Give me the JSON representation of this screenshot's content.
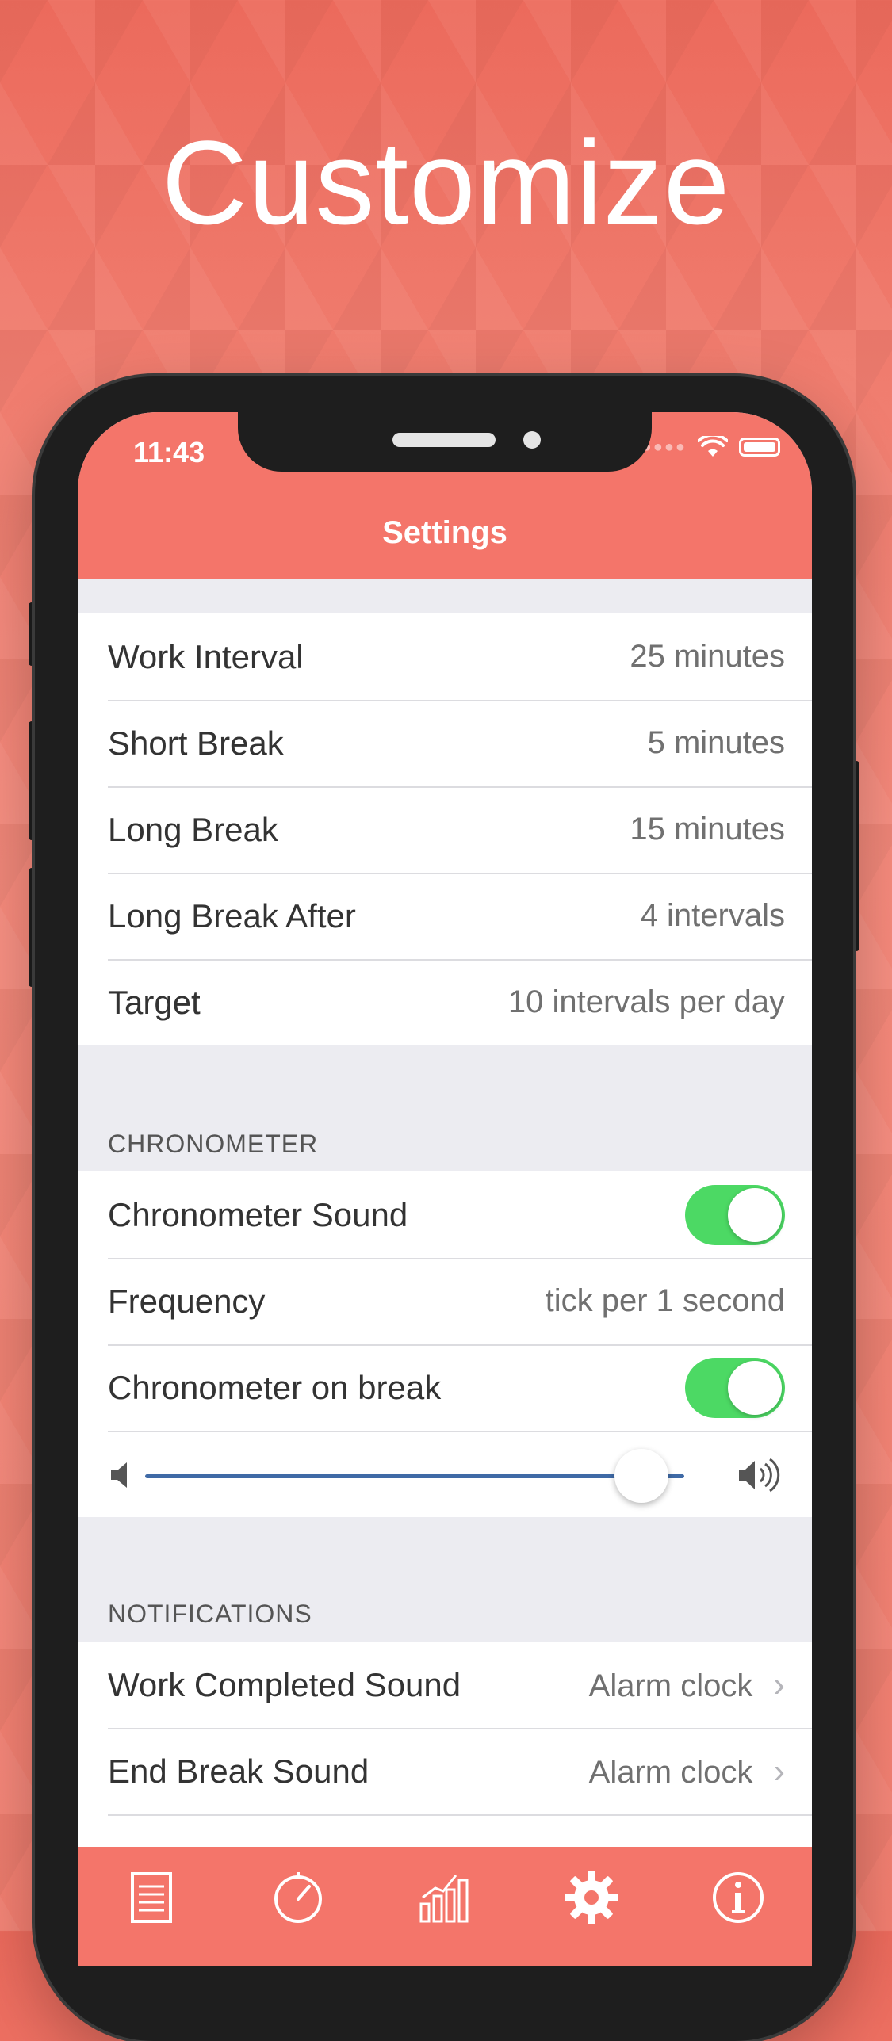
{
  "headline": "Customize",
  "status_bar": {
    "time": "11:43"
  },
  "nav": {
    "title": "Settings"
  },
  "timer_settings": [
    {
      "label": "Work Interval",
      "value": "25 minutes"
    },
    {
      "label": "Short Break",
      "value": "5 minutes"
    },
    {
      "label": "Long Break",
      "value": "15 minutes"
    },
    {
      "label": "Long Break After",
      "value": "4 intervals"
    },
    {
      "label": "Target",
      "value": "10 intervals per day"
    }
  ],
  "chronometer": {
    "header": "CHRONOMETER",
    "sound_label": "Chronometer Sound",
    "sound_on": true,
    "frequency_label": "Frequency",
    "frequency_value": "tick per 1 second",
    "on_break_label": "Chronometer on break",
    "on_break_on": true,
    "volume_fraction": 0.92
  },
  "notifications": {
    "header": "NOTIFICATIONS",
    "items": [
      {
        "label": "Work Completed Sound",
        "value": "Alarm clock"
      },
      {
        "label": "End Break Sound",
        "value": "Alarm clock"
      }
    ]
  },
  "tabbar": {
    "icons": [
      "list-icon",
      "timer-icon",
      "chart-icon",
      "gear-icon",
      "info-icon"
    ],
    "active": "gear-icon"
  },
  "colors": {
    "accent": "#f4756a",
    "toggle_on": "#4cd964",
    "slider": "#3f6aa6"
  }
}
